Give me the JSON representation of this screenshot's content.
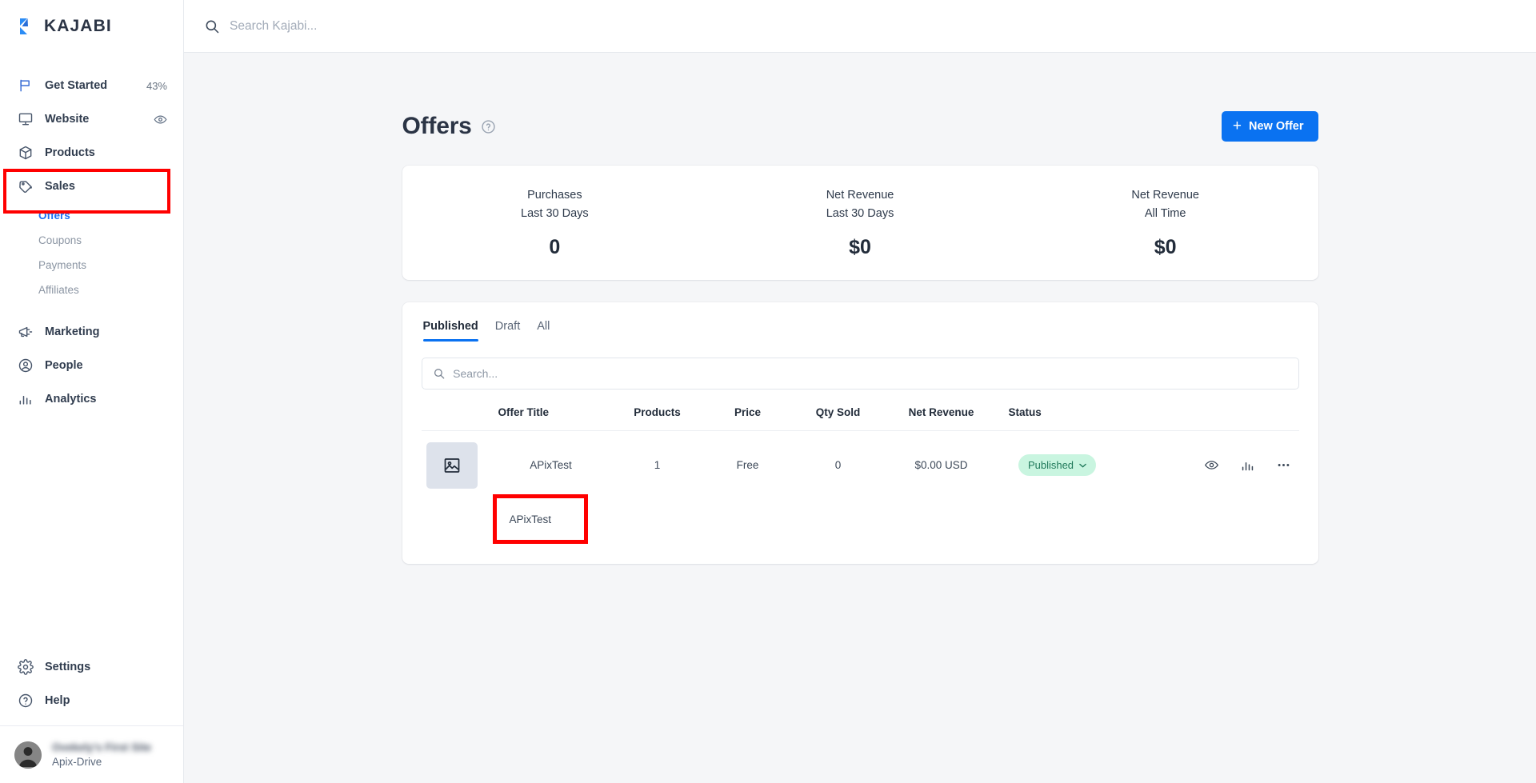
{
  "brand": {
    "name": "KAJABI",
    "logo_icon": "kajabi-k-logo",
    "accent": "#0a72f1"
  },
  "topbar": {
    "search_icon": "search-icon",
    "search_placeholder": "Search Kajabi...",
    "search_value": ""
  },
  "sidebar": {
    "items": [
      {
        "label": "Get Started",
        "icon": "flag-icon",
        "right_text": "43%"
      },
      {
        "label": "Website",
        "icon": "monitor-icon",
        "right_icon": "eye-icon"
      },
      {
        "label": "Products",
        "icon": "box-icon"
      },
      {
        "label": "Sales",
        "icon": "tag-icon"
      },
      {
        "label": "Marketing",
        "icon": "megaphone-icon"
      },
      {
        "label": "People",
        "icon": "user-circle-icon"
      },
      {
        "label": "Analytics",
        "icon": "bar-chart-icon"
      }
    ],
    "sales_sub_items": [
      {
        "label": "Offers",
        "active": true
      },
      {
        "label": "Coupons",
        "active": false
      },
      {
        "label": "Payments",
        "active": false
      },
      {
        "label": "Affiliates",
        "active": false
      }
    ],
    "bottom_items": [
      {
        "label": "Settings",
        "icon": "gear-icon"
      },
      {
        "label": "Help",
        "icon": "question-circle-icon"
      }
    ],
    "user": {
      "name": "",
      "subtitle": "Apix-Drive",
      "avatar_icon": "avatar-icon"
    },
    "highlight_color": "#ff0000"
  },
  "page": {
    "title": "Offers",
    "help_icon": "question-circle-icon",
    "new_offer_button": "New Offer",
    "new_offer_icon": "plus-icon"
  },
  "stats": [
    {
      "title": "Purchases",
      "subtitle": "Last 30 Days",
      "value": "0"
    },
    {
      "title": "Net Revenue",
      "subtitle": "Last 30 Days",
      "value": "$0"
    },
    {
      "title": "Net Revenue",
      "subtitle": "All Time",
      "value": "$0"
    }
  ],
  "tabs": [
    {
      "label": "Published",
      "active": true
    },
    {
      "label": "Draft",
      "active": false
    },
    {
      "label": "All",
      "active": false
    }
  ],
  "table_search": {
    "icon": "search-icon",
    "placeholder": "Search...",
    "value": ""
  },
  "table": {
    "columns": [
      "",
      "Offer Title",
      "Products",
      "Price",
      "Qty Sold",
      "Net Revenue",
      "Status",
      ""
    ],
    "rows": [
      {
        "thumb_icon": "image-placeholder-icon",
        "title": "APixTest",
        "products": "1",
        "price": "Free",
        "qty_sold": "0",
        "net_revenue": "$0.00 USD",
        "status": "Published",
        "status_caret": "chevron-down-icon",
        "actions": [
          "eye-icon",
          "bar-chart-icon",
          "more-horizontal-icon"
        ]
      }
    ],
    "highlight_color": "#ff0000"
  }
}
